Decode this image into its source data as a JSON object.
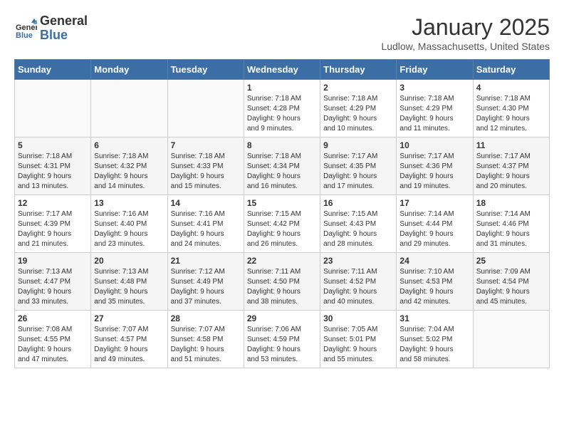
{
  "header": {
    "logo_line1": "General",
    "logo_line2": "Blue",
    "month": "January 2025",
    "location": "Ludlow, Massachusetts, United States"
  },
  "weekdays": [
    "Sunday",
    "Monday",
    "Tuesday",
    "Wednesday",
    "Thursday",
    "Friday",
    "Saturday"
  ],
  "weeks": [
    [
      {
        "day": "",
        "info": ""
      },
      {
        "day": "",
        "info": ""
      },
      {
        "day": "",
        "info": ""
      },
      {
        "day": "1",
        "info": "Sunrise: 7:18 AM\nSunset: 4:28 PM\nDaylight: 9 hours\nand 9 minutes."
      },
      {
        "day": "2",
        "info": "Sunrise: 7:18 AM\nSunset: 4:29 PM\nDaylight: 9 hours\nand 10 minutes."
      },
      {
        "day": "3",
        "info": "Sunrise: 7:18 AM\nSunset: 4:29 PM\nDaylight: 9 hours\nand 11 minutes."
      },
      {
        "day": "4",
        "info": "Sunrise: 7:18 AM\nSunset: 4:30 PM\nDaylight: 9 hours\nand 12 minutes."
      }
    ],
    [
      {
        "day": "5",
        "info": "Sunrise: 7:18 AM\nSunset: 4:31 PM\nDaylight: 9 hours\nand 13 minutes."
      },
      {
        "day": "6",
        "info": "Sunrise: 7:18 AM\nSunset: 4:32 PM\nDaylight: 9 hours\nand 14 minutes."
      },
      {
        "day": "7",
        "info": "Sunrise: 7:18 AM\nSunset: 4:33 PM\nDaylight: 9 hours\nand 15 minutes."
      },
      {
        "day": "8",
        "info": "Sunrise: 7:18 AM\nSunset: 4:34 PM\nDaylight: 9 hours\nand 16 minutes."
      },
      {
        "day": "9",
        "info": "Sunrise: 7:17 AM\nSunset: 4:35 PM\nDaylight: 9 hours\nand 17 minutes."
      },
      {
        "day": "10",
        "info": "Sunrise: 7:17 AM\nSunset: 4:36 PM\nDaylight: 9 hours\nand 19 minutes."
      },
      {
        "day": "11",
        "info": "Sunrise: 7:17 AM\nSunset: 4:37 PM\nDaylight: 9 hours\nand 20 minutes."
      }
    ],
    [
      {
        "day": "12",
        "info": "Sunrise: 7:17 AM\nSunset: 4:39 PM\nDaylight: 9 hours\nand 21 minutes."
      },
      {
        "day": "13",
        "info": "Sunrise: 7:16 AM\nSunset: 4:40 PM\nDaylight: 9 hours\nand 23 minutes."
      },
      {
        "day": "14",
        "info": "Sunrise: 7:16 AM\nSunset: 4:41 PM\nDaylight: 9 hours\nand 24 minutes."
      },
      {
        "day": "15",
        "info": "Sunrise: 7:15 AM\nSunset: 4:42 PM\nDaylight: 9 hours\nand 26 minutes."
      },
      {
        "day": "16",
        "info": "Sunrise: 7:15 AM\nSunset: 4:43 PM\nDaylight: 9 hours\nand 28 minutes."
      },
      {
        "day": "17",
        "info": "Sunrise: 7:14 AM\nSunset: 4:44 PM\nDaylight: 9 hours\nand 29 minutes."
      },
      {
        "day": "18",
        "info": "Sunrise: 7:14 AM\nSunset: 4:46 PM\nDaylight: 9 hours\nand 31 minutes."
      }
    ],
    [
      {
        "day": "19",
        "info": "Sunrise: 7:13 AM\nSunset: 4:47 PM\nDaylight: 9 hours\nand 33 minutes."
      },
      {
        "day": "20",
        "info": "Sunrise: 7:13 AM\nSunset: 4:48 PM\nDaylight: 9 hours\nand 35 minutes."
      },
      {
        "day": "21",
        "info": "Sunrise: 7:12 AM\nSunset: 4:49 PM\nDaylight: 9 hours\nand 37 minutes."
      },
      {
        "day": "22",
        "info": "Sunrise: 7:11 AM\nSunset: 4:50 PM\nDaylight: 9 hours\nand 38 minutes."
      },
      {
        "day": "23",
        "info": "Sunrise: 7:11 AM\nSunset: 4:52 PM\nDaylight: 9 hours\nand 40 minutes."
      },
      {
        "day": "24",
        "info": "Sunrise: 7:10 AM\nSunset: 4:53 PM\nDaylight: 9 hours\nand 42 minutes."
      },
      {
        "day": "25",
        "info": "Sunrise: 7:09 AM\nSunset: 4:54 PM\nDaylight: 9 hours\nand 45 minutes."
      }
    ],
    [
      {
        "day": "26",
        "info": "Sunrise: 7:08 AM\nSunset: 4:55 PM\nDaylight: 9 hours\nand 47 minutes."
      },
      {
        "day": "27",
        "info": "Sunrise: 7:07 AM\nSunset: 4:57 PM\nDaylight: 9 hours\nand 49 minutes."
      },
      {
        "day": "28",
        "info": "Sunrise: 7:07 AM\nSunset: 4:58 PM\nDaylight: 9 hours\nand 51 minutes."
      },
      {
        "day": "29",
        "info": "Sunrise: 7:06 AM\nSunset: 4:59 PM\nDaylight: 9 hours\nand 53 minutes."
      },
      {
        "day": "30",
        "info": "Sunrise: 7:05 AM\nSunset: 5:01 PM\nDaylight: 9 hours\nand 55 minutes."
      },
      {
        "day": "31",
        "info": "Sunrise: 7:04 AM\nSunset: 5:02 PM\nDaylight: 9 hours\nand 58 minutes."
      },
      {
        "day": "",
        "info": ""
      }
    ]
  ]
}
